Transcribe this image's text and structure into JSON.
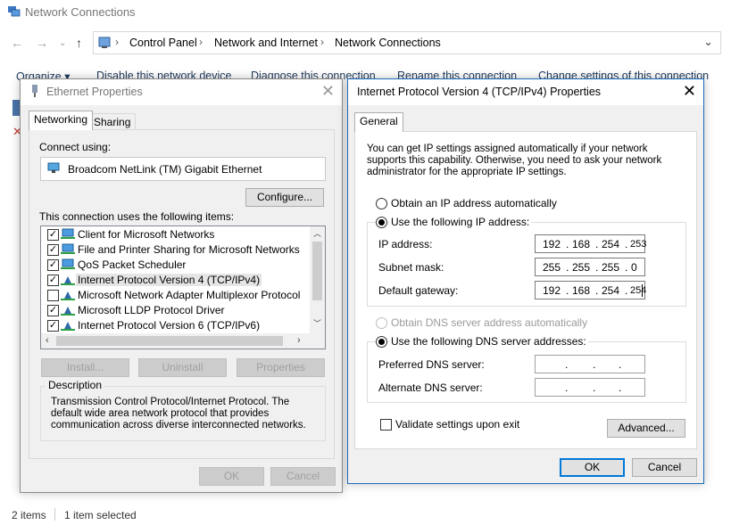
{
  "explorer": {
    "title": "Network Connections",
    "breadcrumb": [
      "Control Panel",
      "Network and Internet",
      "Network Connections"
    ],
    "commands": [
      "Organize ▾",
      "Disable this network device",
      "Diagnose this connection",
      "Rename this connection",
      "Change settings of this connection"
    ],
    "status": {
      "items": "2 items",
      "selected": "1 item selected"
    }
  },
  "ethernet": {
    "title": "Ethernet Properties",
    "tabs": [
      "Networking",
      "Sharing"
    ],
    "connect_using_label": "Connect using:",
    "adapter": "Broadcom NetLink (TM) Gigabit Ethernet",
    "configure_label": "Configure...",
    "items_label": "This connection uses the following items:",
    "items": [
      {
        "label": "Client for Microsoft Networks",
        "checked": true
      },
      {
        "label": "File and Printer Sharing for Microsoft Networks",
        "checked": true
      },
      {
        "label": "QoS Packet Scheduler",
        "checked": true
      },
      {
        "label": "Internet Protocol Version 4 (TCP/IPv4)",
        "checked": true
      },
      {
        "label": "Microsoft Network Adapter Multiplexor Protocol",
        "checked": false
      },
      {
        "label": "Microsoft LLDP Protocol Driver",
        "checked": true
      },
      {
        "label": "Internet Protocol Version 6 (TCP/IPv6)",
        "checked": true
      }
    ],
    "install_label": "Install...",
    "uninstall_label": "Uninstall",
    "properties_label": "Properties",
    "description_label": "Description",
    "description_text": "Transmission Control Protocol/Internet Protocol. The default wide area network protocol that provides communication across diverse interconnected networks.",
    "ok_label": "OK",
    "cancel_label": "Cancel"
  },
  "ipv4": {
    "title": "Internet Protocol Version 4 (TCP/IPv4) Properties",
    "tab": "General",
    "intro": "You can get IP settings assigned automatically if your network supports this capability. Otherwise, you need to ask your network administrator for the appropriate IP settings.",
    "obtain_ip_auto": "Obtain an IP address automatically",
    "use_following_ip": "Use the following IP address:",
    "ip_label": "IP address:",
    "ip": [
      "192",
      "168",
      "254",
      "253"
    ],
    "mask_label": "Subnet mask:",
    "mask": [
      "255",
      "255",
      "255",
      "0"
    ],
    "gateway_label": "Default gateway:",
    "gateway": [
      "192",
      "168",
      "254",
      "254"
    ],
    "obtain_dns_auto": "Obtain DNS server address automatically",
    "use_following_dns": "Use the following DNS server addresses:",
    "preferred_dns_label": "Preferred DNS server:",
    "alternate_dns_label": "Alternate DNS server:",
    "dot": ".",
    "validate_label": "Validate settings upon exit",
    "advanced_label": "Advanced...",
    "ok_label": "OK",
    "cancel_label": "Cancel"
  }
}
